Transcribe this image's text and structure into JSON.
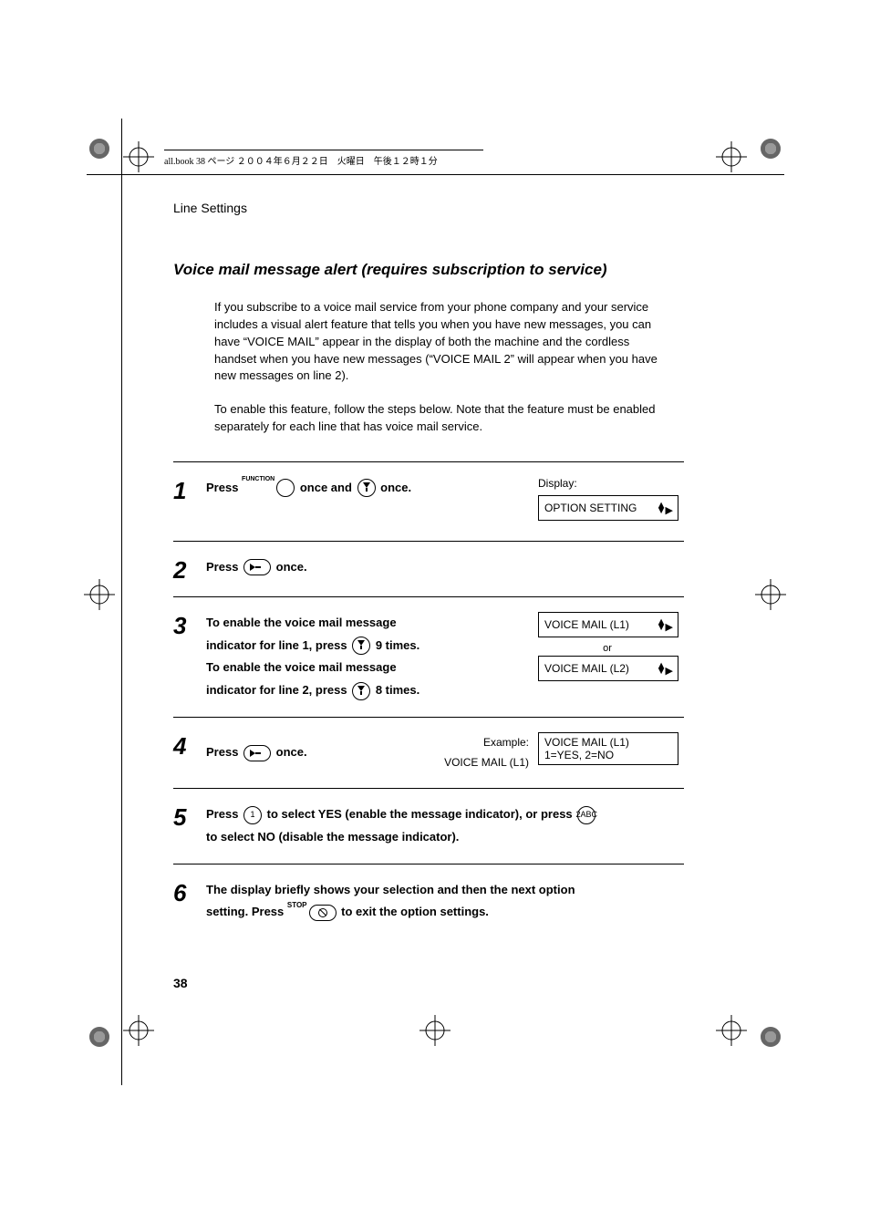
{
  "meta_line": "all.book  38 ページ  ２００４年６月２２日　火曜日　午後１２時１分",
  "running_head": "Line Settings",
  "section_title": "Voice mail message alert (requires subscription to service)",
  "para1": "If you subscribe to a voice mail service from your phone company and your service includes a visual alert feature that tells you when you have new messages, you can have “VOICE MAIL” appear in the display of both the machine and the cordless handset when you have new messages (“VOICE MAIL 2” will appear when you have new messages on line 2).",
  "para2": "To enable this feature, follow the steps below. Note that the feature must be enabled separately for each line that has voice mail service.",
  "steps": {
    "s1": {
      "press": "Press ",
      "function_label": "FUNCTION",
      "mid": " once and ",
      "end": " once.",
      "display_label": "Display:",
      "display_value": "OPTION SETTING"
    },
    "s2": {
      "press": "Press ",
      "end": " once."
    },
    "s3": {
      "line1a": "To enable the voice mail message",
      "line1b": "indicator for line 1, press ",
      "line1c": " 9 times.",
      "line2a": "To enable the voice mail message",
      "line2b": "indicator for line 2, press ",
      "line2c": " 8 times.",
      "disp1": "VOICE MAIL (L1)",
      "or": "or",
      "disp2": "VOICE MAIL (L2)"
    },
    "s4": {
      "press": "Press ",
      "end": " once.",
      "example_label": "Example:",
      "example_value": "VOICE MAIL (L1)",
      "disp_line1": "VOICE MAIL (L1)",
      "disp_line2": "1=YES, 2=NO"
    },
    "s5": {
      "a": "Press ",
      "key1": "1",
      "b": " to select YES (enable the message indicator), or press ",
      "key2": "2ABC",
      "c": "to select NO (disable the message indicator)."
    },
    "s6": {
      "a": "The display briefly shows your selection and then the next option",
      "b": "setting. Press ",
      "stop_label": "STOP",
      "c": " to exit the option settings."
    }
  },
  "page_number": "38"
}
